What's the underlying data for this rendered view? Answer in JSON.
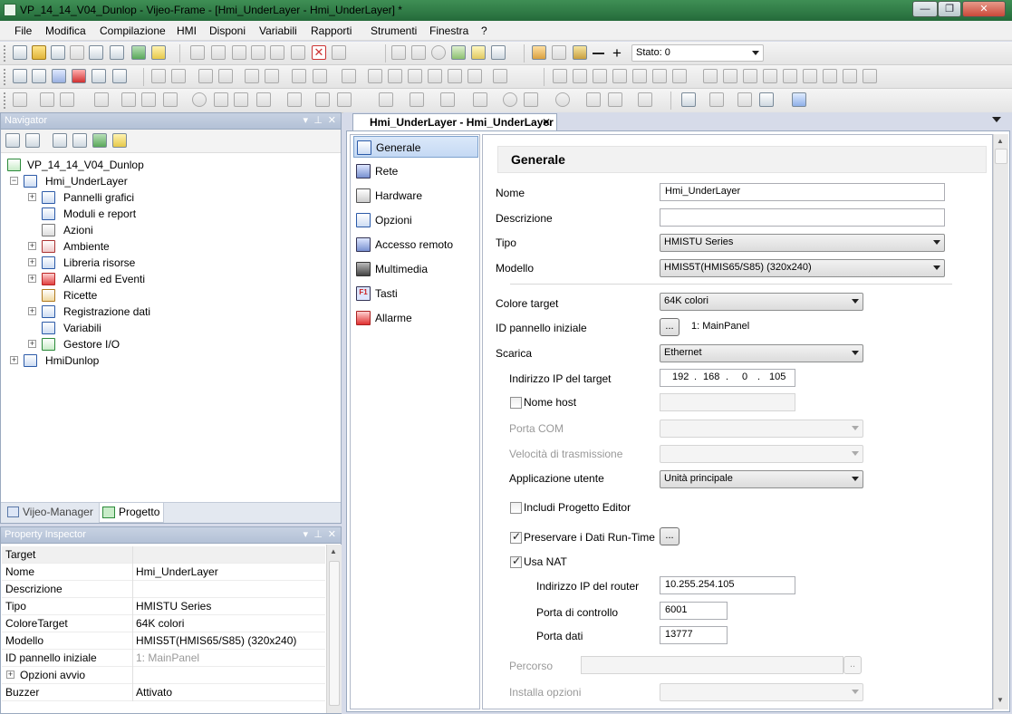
{
  "window": {
    "title": "VP_14_14_V04_Dunlop - Vijeo-Frame - [Hmi_UnderLayer - Hmi_UnderLayer] *",
    "minimize": "—",
    "maximize": "❐",
    "close": "✕"
  },
  "menu": [
    "File",
    "Modifica",
    "Compilazione",
    "HMI",
    "Disponi",
    "Variabili",
    "Rapporti",
    "Strumenti",
    "Finestra",
    "?"
  ],
  "toolbar": {
    "state_label": "Stato: 0"
  },
  "navigator": {
    "title": "Navigator",
    "tree": [
      {
        "label": "VP_14_14_V04_Dunlop",
        "level": 0,
        "expander": "",
        "icon": "project-icon"
      },
      {
        "label": "Hmi_UnderLayer",
        "level": 1,
        "expander": "−",
        "icon": "hmi-icon"
      },
      {
        "label": "Pannelli grafici",
        "level": 2,
        "expander": "+",
        "icon": "panel-icon"
      },
      {
        "label": "Moduli e report",
        "level": 2,
        "expander": "",
        "icon": "report-icon"
      },
      {
        "label": "Azioni",
        "level": 2,
        "expander": "",
        "icon": "action-icon"
      },
      {
        "label": "Ambiente",
        "level": 2,
        "expander": "+",
        "icon": "environment-icon"
      },
      {
        "label": "Libreria risorse",
        "level": 2,
        "expander": "+",
        "icon": "library-icon"
      },
      {
        "label": "Allarmi ed Eventi",
        "level": 2,
        "expander": "+",
        "icon": "alarm-icon"
      },
      {
        "label": "Ricette",
        "level": 2,
        "expander": "",
        "icon": "recipe-icon"
      },
      {
        "label": "Registrazione dati",
        "level": 2,
        "expander": "+",
        "icon": "datalog-icon"
      },
      {
        "label": "Variabili",
        "level": 2,
        "expander": "",
        "icon": "variables-icon"
      },
      {
        "label": "Gestore I/O",
        "level": 2,
        "expander": "+",
        "icon": "io-manager-icon"
      },
      {
        "label": "HmiDunlop",
        "level": 1,
        "expander": "+",
        "icon": "hmi-icon"
      }
    ],
    "tabs": [
      "Vijeo-Manager",
      "Progetto"
    ]
  },
  "inspector": {
    "title": "Property Inspector",
    "header": "Target",
    "rows": [
      {
        "key": "Nome",
        "value": "Hmi_UnderLayer"
      },
      {
        "key": "Descrizione",
        "value": ""
      },
      {
        "key": "Tipo",
        "value": "HMISTU Series"
      },
      {
        "key": "ColoreTarget",
        "value": "64K colori"
      },
      {
        "key": "Modello",
        "value": "HMIS5T(HMIS65/S85) (320x240)"
      },
      {
        "key": "ID pannello iniziale",
        "value": "1: MainPanel"
      },
      {
        "key": "Opzioni avvio",
        "value": "",
        "expander": "+"
      },
      {
        "key": "Buzzer",
        "value": "Attivato"
      }
    ]
  },
  "document": {
    "tab": "Hmi_UnderLayer - Hmi_UnderLayer",
    "tab_close": "✕",
    "categories": [
      {
        "label": "Generale",
        "icon": "general-icon"
      },
      {
        "label": "Rete",
        "icon": "network-icon"
      },
      {
        "label": "Hardware",
        "icon": "hardware-icon"
      },
      {
        "label": "Opzioni",
        "icon": "options-icon"
      },
      {
        "label": "Accesso remoto",
        "icon": "remote-access-icon"
      },
      {
        "label": "Multimedia",
        "icon": "multimedia-icon"
      },
      {
        "label": "Tasti",
        "icon": "keys-icon"
      },
      {
        "label": "Allarme",
        "icon": "alarm-light-icon"
      }
    ],
    "section_title": "Generale",
    "fields": {
      "nome_label": "Nome",
      "nome_value": "Hmi_UnderLayer",
      "descrizione_label": "Descrizione",
      "descrizione_value": "",
      "tipo_label": "Tipo",
      "tipo_value": "HMISTU Series",
      "modello_label": "Modello",
      "modello_value": "HMIS5T(HMIS65/S85) (320x240)",
      "colore_label": "Colore target",
      "colore_value": "64K colori",
      "idpannello_label": "ID pannello iniziale",
      "idpannello_button": "...",
      "idpannello_value": "1: MainPanel",
      "scarica_label": "Scarica",
      "scarica_value": "Ethernet",
      "ip_label": "Indirizzo IP del target",
      "ip_octets": [
        "192",
        "168",
        "0",
        "105"
      ],
      "ip_dot": ".",
      "nomehost_label": "Nome host",
      "nomehost_value": "",
      "portacom_label": "Porta COM",
      "velocita_label": "Velocità di trasmissione",
      "applicazione_label": "Applicazione utente",
      "applicazione_value": "Unità principale",
      "includi_label": "Includi Progetto Editor",
      "preservare_label": "Preservare i Dati Run-Time",
      "preservare_button": "...",
      "nat_label": "Usa NAT",
      "router_label": "Indirizzo IP del router",
      "router_value": "10.255.254.105",
      "controllo_label": "Porta di controllo",
      "controllo_value": "6001",
      "dati_label": "Porta dati",
      "dati_value": "13777",
      "percorso_label": "Percorso",
      "percorso_button": "..",
      "installa_label": "Installa opzioni"
    },
    "checkboxes": {
      "nomehost": false,
      "includi": false,
      "preservare": true,
      "nat": true
    }
  }
}
